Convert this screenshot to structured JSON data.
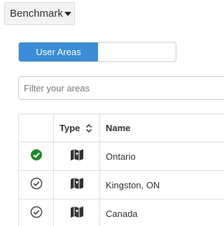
{
  "benchmark": {
    "label": "Benchmark",
    "icon": "caret-down-icon"
  },
  "toggle": {
    "active_label": "User Areas",
    "active_color": "#3a8dd6"
  },
  "filter": {
    "placeholder": "Filter your areas",
    "value": ""
  },
  "table": {
    "columns": [
      {
        "label": ""
      },
      {
        "label": "Type",
        "icon": "sort-icon"
      },
      {
        "label": "Name"
      }
    ],
    "rows": [
      {
        "status": "selected",
        "status_icon": "check-circle-filled-icon",
        "type_icon": "map-icon",
        "name": "Ontario"
      },
      {
        "status": "unselected",
        "status_icon": "check-circle-outline-icon",
        "type_icon": "map-icon",
        "name": "Kingston, ON"
      },
      {
        "status": "unselected",
        "status_icon": "check-circle-outline-icon",
        "type_icon": "map-icon",
        "name": "Canada"
      }
    ]
  },
  "colors": {
    "check_selected": "#1f8a2e",
    "check_outline": "#555555",
    "map_icon": "#333333"
  }
}
